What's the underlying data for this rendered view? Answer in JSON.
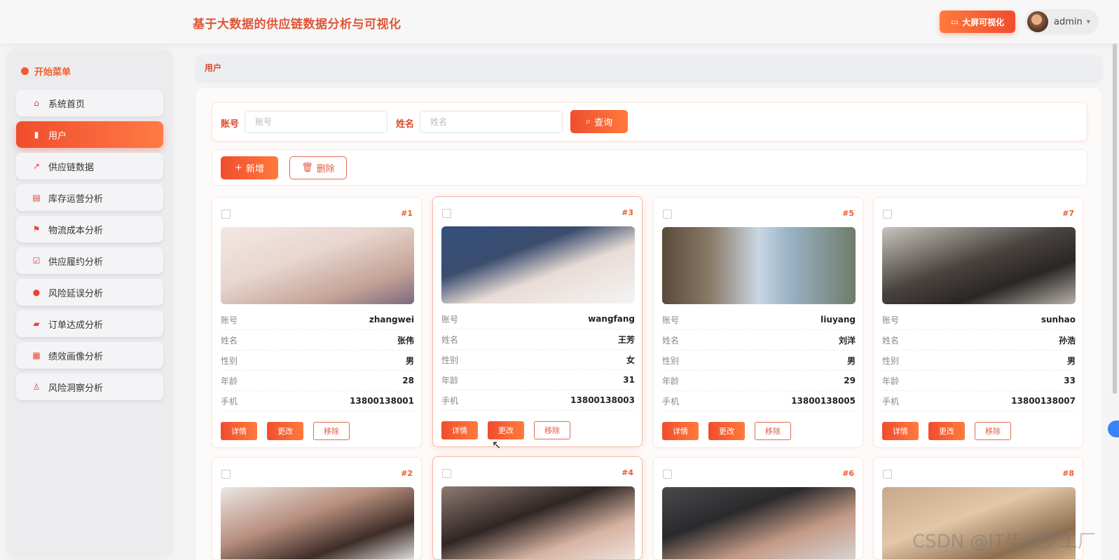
{
  "header": {
    "title": "基于大数据的供应链数据分析与可视化",
    "bigscreen_label": "大屏可视化",
    "username": "admin"
  },
  "sidebar": {
    "heading": "开始菜单",
    "items": [
      {
        "label": "系统首页",
        "icon": "home-icon"
      },
      {
        "label": "用户",
        "icon": "bar-chart-icon"
      },
      {
        "label": "供应链数据",
        "icon": "line-chart-icon"
      },
      {
        "label": "库存运营分析",
        "icon": "clipboard-icon"
      },
      {
        "label": "物流成本分析",
        "icon": "flag-icon"
      },
      {
        "label": "供应履约分析",
        "icon": "check-clipboard-icon"
      },
      {
        "label": "风险延误分析",
        "icon": "balloon-icon"
      },
      {
        "label": "订单达成分析",
        "icon": "wallet-icon"
      },
      {
        "label": "绩效画像分析",
        "icon": "grid-icon"
      },
      {
        "label": "风险洞察分析",
        "icon": "user-icon"
      }
    ]
  },
  "breadcrumb": "用户",
  "search": {
    "account_label": "账号",
    "account_placeholder": "账号",
    "name_label": "姓名",
    "name_placeholder": "姓名",
    "query_label": "查询"
  },
  "actions": {
    "add_label": "新增",
    "delete_label": "删除"
  },
  "field_labels": {
    "account": "账号",
    "name": "姓名",
    "gender": "性别",
    "age": "年龄",
    "phone": "手机"
  },
  "card_buttons": {
    "detail": "详情",
    "edit": "更改",
    "remove": "移除"
  },
  "users": [
    {
      "id": "#1",
      "account": "zhangwei",
      "name": "张伟",
      "gender": "男",
      "age": "28",
      "phone": "13800138001"
    },
    {
      "id": "#3",
      "account": "wangfang",
      "name": "王芳",
      "gender": "女",
      "age": "31",
      "phone": "13800138003"
    },
    {
      "id": "#5",
      "account": "liuyang",
      "name": "刘洋",
      "gender": "男",
      "age": "29",
      "phone": "13800138005"
    },
    {
      "id": "#7",
      "account": "sunhao",
      "name": "孙浩",
      "gender": "男",
      "age": "33",
      "phone": "13800138007"
    },
    {
      "id": "#2"
    },
    {
      "id": "#4"
    },
    {
      "id": "#6"
    },
    {
      "id": "#8"
    }
  ],
  "watermark": "CSDN @IT毕设梦工厂",
  "colors": {
    "accent": "#f04d2e",
    "accent_light": "#ff7a3d"
  }
}
